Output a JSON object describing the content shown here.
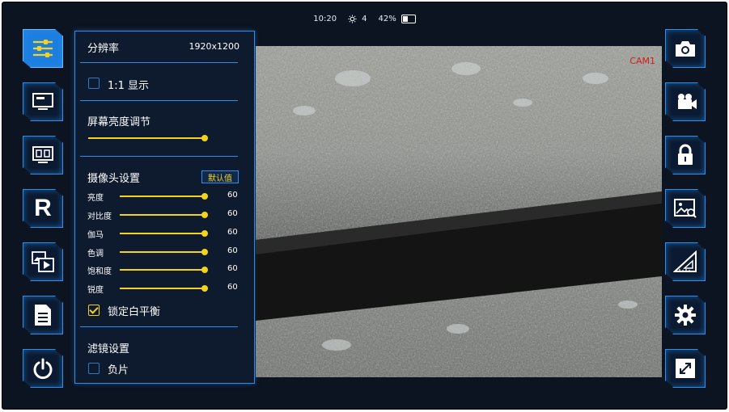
{
  "status": {
    "time": "10:20",
    "brightness": "4",
    "battery": "42%"
  },
  "left_sidebar": [
    {
      "name": "settings",
      "active": true
    },
    {
      "name": "display"
    },
    {
      "name": "split-screen"
    },
    {
      "name": "reset",
      "label": "R"
    },
    {
      "name": "media"
    },
    {
      "name": "document"
    },
    {
      "name": "power"
    }
  ],
  "right_sidebar": [
    "camera",
    "video",
    "lock",
    "image-search",
    "measure",
    "gear",
    "fullscreen"
  ],
  "panel": {
    "resolution_label": "分辨率",
    "resolution_value": "1920x1200",
    "one_to_one_label": "1:1 显示",
    "one_to_one_checked": false,
    "brightness_title": "屏幕亮度调节",
    "screen_brightness": 1.0,
    "camera_settings_title": "摄像头设置",
    "default_button": "默认值",
    "sliders": [
      {
        "label": "亮度",
        "value": "60",
        "level": 1.0
      },
      {
        "label": "对比度",
        "value": "60",
        "level": 1.0
      },
      {
        "label": "伽马",
        "value": "60",
        "level": 1.0
      },
      {
        "label": "色调",
        "value": "60",
        "level": 1.0
      },
      {
        "label": "饱和度",
        "value": "60",
        "level": 1.0
      },
      {
        "label": "锐度",
        "value": "60",
        "level": 1.0
      }
    ],
    "lock_wb_label": "锁定白平衡",
    "lock_wb_checked": true,
    "filter_title": "滤镜设置",
    "negative_label": "负片",
    "negative_checked": false
  },
  "camera_view": {
    "overlay_text": "CAM1"
  },
  "colors": {
    "accent": "#2c8ff0",
    "slider": "#f5d21c",
    "background": "#0c1321"
  }
}
